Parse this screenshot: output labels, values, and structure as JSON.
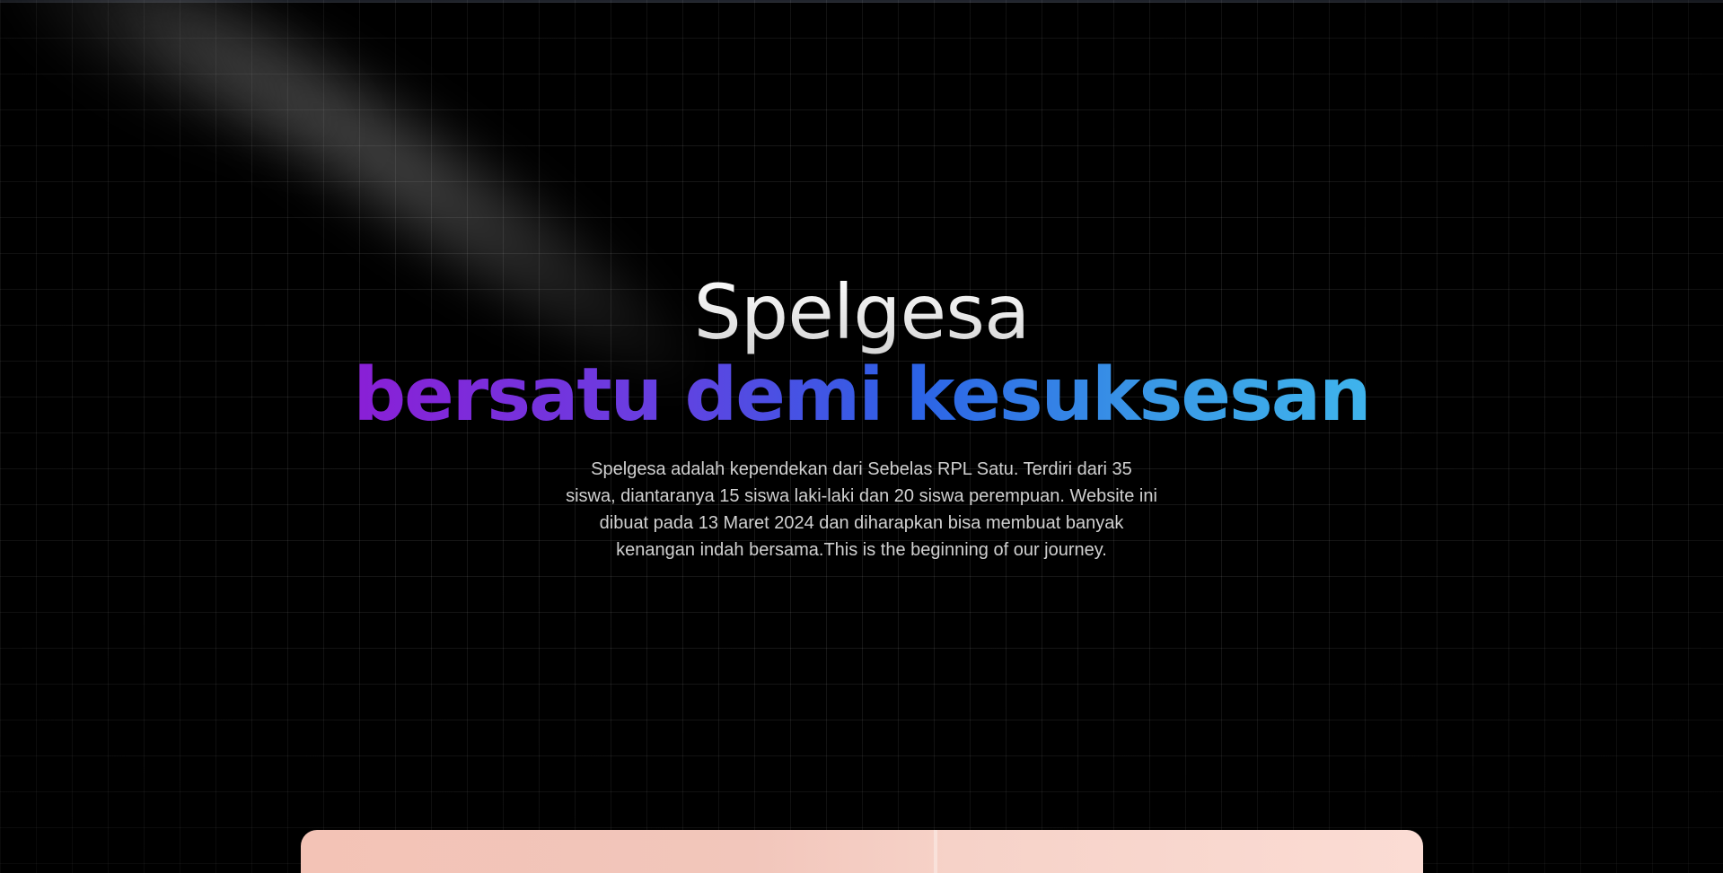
{
  "hero": {
    "title": "Spelgesa",
    "tagline": "bersatu demi kesuksesan",
    "description": "Spelgesa adalah kependekan dari Sebelas RPL Satu. Terdiri dari 35 siswa, diantaranya 15 siswa laki-laki dan 20 siswa perempuan. Website ini dibuat pada 13 Maret 2024 dan diharapkan bisa membuat banyak kenangan indah bersama.This is the beginning of our journey."
  },
  "colors": {
    "background": "#000000",
    "tagline_gradient_start": "#8a1fd6",
    "tagline_gradient_mid": "#2c62e6",
    "tagline_gradient_end": "#3fb4ec",
    "description_text": "#d0d0d0",
    "card_preview": "#f3c3b6"
  }
}
